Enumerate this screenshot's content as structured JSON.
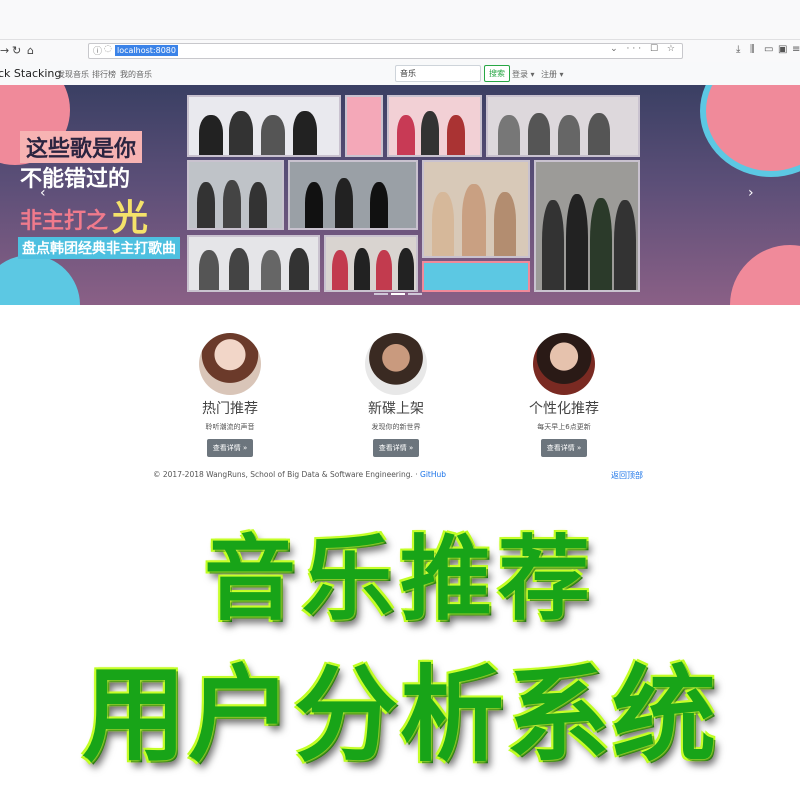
{
  "browser": {
    "url": "localhost:8080",
    "url_actions": "⌄ ··· ☐ ☆"
  },
  "site": {
    "brand": "ck Stacking",
    "nav": [
      "发现音乐",
      "排行榜",
      "我的音乐"
    ],
    "search_value": "音乐",
    "search_button": "搜索",
    "login": "登录",
    "register": "注册"
  },
  "banner": {
    "line1": "这些歌是你",
    "line2": "不能错过的",
    "line3": "非主打之",
    "line3_big": "光",
    "line4": "盘点韩团经典非主打歌曲"
  },
  "features": [
    {
      "title": "热门推荐",
      "desc": "聆听潮流的声音",
      "button": "查看详情 »"
    },
    {
      "title": "新碟上架",
      "desc": "发现你的新世界",
      "button": "查看详情 »"
    },
    {
      "title": "个性化推荐",
      "desc": "每天早上6点更新",
      "button": "查看详情 »"
    }
  ],
  "footer": {
    "copyright": "© 2017-2018 WangRuns, School of Big Data & Software Engineering. · ",
    "github": "GitHub",
    "back_to_top": "返回顶部"
  },
  "overlay": {
    "line1": "音乐推荐",
    "line2": "用户分析系统"
  },
  "colors": {
    "overlay_text": "#18a418",
    "overlay_glow": "#d8ff3a",
    "search_button": "#28a745",
    "link": "#1a73e8"
  }
}
